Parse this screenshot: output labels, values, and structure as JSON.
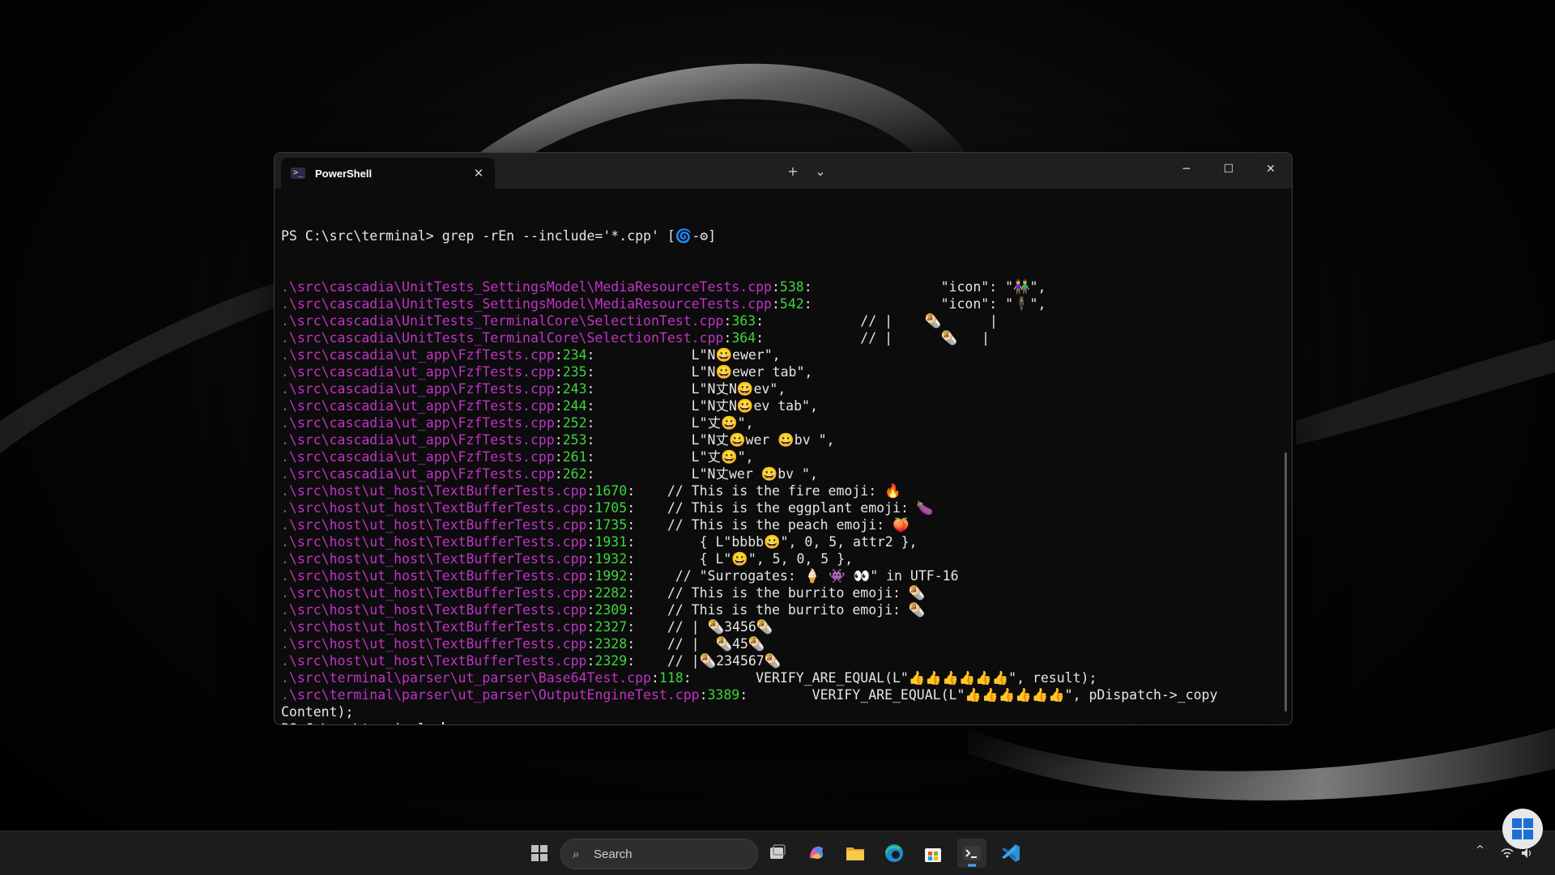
{
  "window": {
    "tab_title": "PowerShell",
    "tab_icon": "powershell-icon",
    "new_tab_label": "+",
    "dropdown_label": "⌄",
    "close_tab_label": "✕",
    "minimize_label": "─",
    "maximize_label": "☐",
    "close_label": "✕"
  },
  "terminal": {
    "prompt": "PS C:\\src\\terminal> ",
    "command": "grep -rEn --include='*.cpp' [🌀-⚙]",
    "lines": [
      {
        "path": ".\\src\\cascadia\\UnitTests_SettingsModel\\MediaResourceTests.cpp",
        "num": "538",
        "code": "                \"icon\": \"👫\","
      },
      {
        "path": ".\\src\\cascadia\\UnitTests_SettingsModel\\MediaResourceTests.cpp",
        "num": "542",
        "code": "                \"icon\": \"🕴\","
      },
      {
        "path": ".\\src\\cascadia\\UnitTests_TerminalCore\\SelectionTest.cpp",
        "num": "363",
        "code": "            // |    🌯      |"
      },
      {
        "path": ".\\src\\cascadia\\UnitTests_TerminalCore\\SelectionTest.cpp",
        "num": "364",
        "code": "            // |      🌯   |"
      },
      {
        "path": ".\\src\\cascadia\\ut_app\\FzfTests.cpp",
        "num": "234",
        "code": "            L\"N😀ewer\","
      },
      {
        "path": ".\\src\\cascadia\\ut_app\\FzfTests.cpp",
        "num": "235",
        "code": "            L\"N😀ewer tab\","
      },
      {
        "path": ".\\src\\cascadia\\ut_app\\FzfTests.cpp",
        "num": "243",
        "code": "            L\"N丈N😀ev\","
      },
      {
        "path": ".\\src\\cascadia\\ut_app\\FzfTests.cpp",
        "num": "244",
        "code": "            L\"N丈N😀ev tab\","
      },
      {
        "path": ".\\src\\cascadia\\ut_app\\FzfTests.cpp",
        "num": "252",
        "code": "            L\"丈😀\","
      },
      {
        "path": ".\\src\\cascadia\\ut_app\\FzfTests.cpp",
        "num": "253",
        "code": "            L\"N丈😀wer 😀bv \","
      },
      {
        "path": ".\\src\\cascadia\\ut_app\\FzfTests.cpp",
        "num": "261",
        "code": "            L\"丈😀\","
      },
      {
        "path": ".\\src\\cascadia\\ut_app\\FzfTests.cpp",
        "num": "262",
        "code": "            L\"N丈wer 😀bv \","
      },
      {
        "path": ".\\src\\host\\ut_host\\TextBufferTests.cpp",
        "num": "1670",
        "code": "    // This is the fire emoji: 🔥"
      },
      {
        "path": ".\\src\\host\\ut_host\\TextBufferTests.cpp",
        "num": "1705",
        "code": "    // This is the eggplant emoji: 🍆"
      },
      {
        "path": ".\\src\\host\\ut_host\\TextBufferTests.cpp",
        "num": "1735",
        "code": "    // This is the peach emoji: 🍑"
      },
      {
        "path": ".\\src\\host\\ut_host\\TextBufferTests.cpp",
        "num": "1931",
        "code": "        { L\"bbbb😀\", 0, 5, attr2 },"
      },
      {
        "path": ".\\src\\host\\ut_host\\TextBufferTests.cpp",
        "num": "1932",
        "code": "        { L\"😀\", 5, 0, 5 },"
      },
      {
        "path": ".\\src\\host\\ut_host\\TextBufferTests.cpp",
        "num": "1992",
        "code": "     // \"Surrogates: 🍦 👾 👀\" in UTF-16"
      },
      {
        "path": ".\\src\\host\\ut_host\\TextBufferTests.cpp",
        "num": "2282",
        "code": "    // This is the burrito emoji: 🌯"
      },
      {
        "path": ".\\src\\host\\ut_host\\TextBufferTests.cpp",
        "num": "2309",
        "code": "    // This is the burrito emoji: 🌯"
      },
      {
        "path": ".\\src\\host\\ut_host\\TextBufferTests.cpp",
        "num": "2327",
        "code": "    // | 🌯3456🌯"
      },
      {
        "path": ".\\src\\host\\ut_host\\TextBufferTests.cpp",
        "num": "2328",
        "code": "    // |  🌯45🌯"
      },
      {
        "path": ".\\src\\host\\ut_host\\TextBufferTests.cpp",
        "num": "2329",
        "code": "    // |🌯234567🌯"
      },
      {
        "path": ".\\src\\terminal\\parser\\ut_parser\\Base64Test.cpp",
        "num": "118",
        "code": "        VERIFY_ARE_EQUAL(L\"👍👍👍👍👍👍\", result);"
      },
      {
        "path": ".\\src\\terminal\\parser\\ut_parser\\OutputEngineTest.cpp",
        "num": "3389",
        "code": "        VERIFY_ARE_EQUAL(L\"👍👍👍👍👍👍\", pDispatch->_copy"
      }
    ],
    "wrap_line": "Content);",
    "final_prompt": "PS C:\\src\\terminal> "
  },
  "taskbar": {
    "search_placeholder": "Search",
    "search_icon": "search-icon",
    "items": [
      "start-icon",
      "task-view-icon",
      "copilot-icon",
      "file-explorer-icon",
      "edge-icon",
      "store-icon",
      "terminal-icon",
      "vscode-icon"
    ],
    "tray_chevron": "^"
  }
}
